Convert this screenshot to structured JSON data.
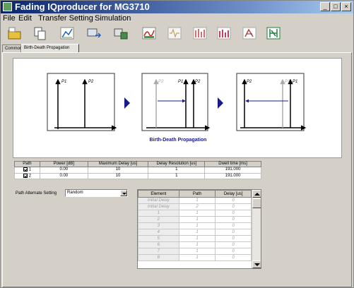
{
  "window": {
    "title": "Fading IQproducer for MG3710"
  },
  "menu": [
    "File",
    "Edit",
    "Transfer Setting",
    "Simulation"
  ],
  "toolbar_icons": [
    "open-folder-icon",
    "copy-icon",
    "chart-icon",
    "transfer-icon",
    "settings-icon",
    "graph-icon",
    "waveform-icon",
    "spectrum-icon",
    "bar-chart-icon",
    "path-icon",
    "fading-icon"
  ],
  "tabs": [
    {
      "label": "Common",
      "active": false
    },
    {
      "label": "Birth-Death Propagation",
      "active": true
    }
  ],
  "diagram": {
    "caption": "Birth-Death  Propagation",
    "labels": {
      "p1": "P1",
      "p2": "P2"
    }
  },
  "path_table": {
    "headers": [
      "Path",
      "Power [dB]",
      "Maximum Delay [us]",
      "Delay Resolution [us]",
      "Dwell time [ms]"
    ],
    "rows": [
      {
        "path": "1",
        "power": "0.00",
        "max_delay": "10",
        "resolution": "1",
        "dwell": "191.000"
      },
      {
        "path": "2",
        "power": "0.00",
        "max_delay": "10",
        "resolution": "1",
        "dwell": "191.000"
      }
    ]
  },
  "alternate": {
    "label": "Path Alternate Setting",
    "value": "Random"
  },
  "element_table": {
    "headers": [
      "Element",
      "Path",
      "Delay [us]"
    ],
    "rows": [
      {
        "element": "Initial Delay",
        "path": "1",
        "delay": "0"
      },
      {
        "element": "Initial Delay",
        "path": "2",
        "delay": "0"
      },
      {
        "element": "1",
        "path": "1",
        "delay": "0"
      },
      {
        "element": "2",
        "path": "1",
        "delay": "0"
      },
      {
        "element": "3",
        "path": "1",
        "delay": "0"
      },
      {
        "element": "4",
        "path": "1",
        "delay": "0"
      },
      {
        "element": "5",
        "path": "1",
        "delay": "0"
      },
      {
        "element": "6",
        "path": "1",
        "delay": "0"
      },
      {
        "element": "7",
        "path": "1",
        "delay": "0"
      },
      {
        "element": "8",
        "path": "1",
        "delay": "0"
      }
    ]
  },
  "colors": {
    "titlebar": "#0a246a",
    "arrow": "#1a1a8c",
    "caption": "#1a1a8c"
  }
}
